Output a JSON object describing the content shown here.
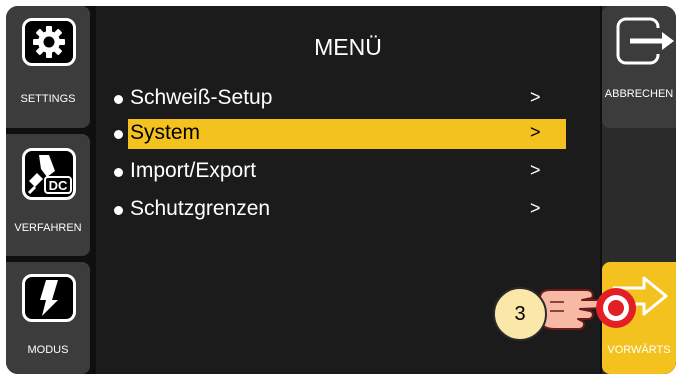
{
  "menu": {
    "title": "MENÜ",
    "items": [
      {
        "label": "Schweiß-Setup",
        "arrow": ">",
        "selected": false
      },
      {
        "label": "System",
        "arrow": ">",
        "selected": true
      },
      {
        "label": "Import/Export",
        "arrow": ">",
        "selected": false
      },
      {
        "label": "Schutzgrenzen",
        "arrow": ">",
        "selected": false
      }
    ]
  },
  "sidebar_left": {
    "settings": {
      "label": "SETTINGS",
      "icon": "gear-icon"
    },
    "verfahren": {
      "label": "VERFAHREN",
      "icon": "welding-torch-dc-icon",
      "badge": "DC"
    },
    "modus": {
      "label": "MODUS",
      "icon": "torch-mode-icon"
    }
  },
  "sidebar_right": {
    "abbrechen": {
      "label": "ABBRECHEN",
      "icon": "exit-arrow-icon"
    },
    "vorwaerts": {
      "label": "VORWÄRTS",
      "icon": "forward-arrow-icon",
      "color": "#f4c21f"
    }
  },
  "step_marker": {
    "number": "3"
  },
  "colors": {
    "highlight": "#f4c21f",
    "background": "#1b1b1b",
    "sidebar": "#3c3c3c"
  }
}
